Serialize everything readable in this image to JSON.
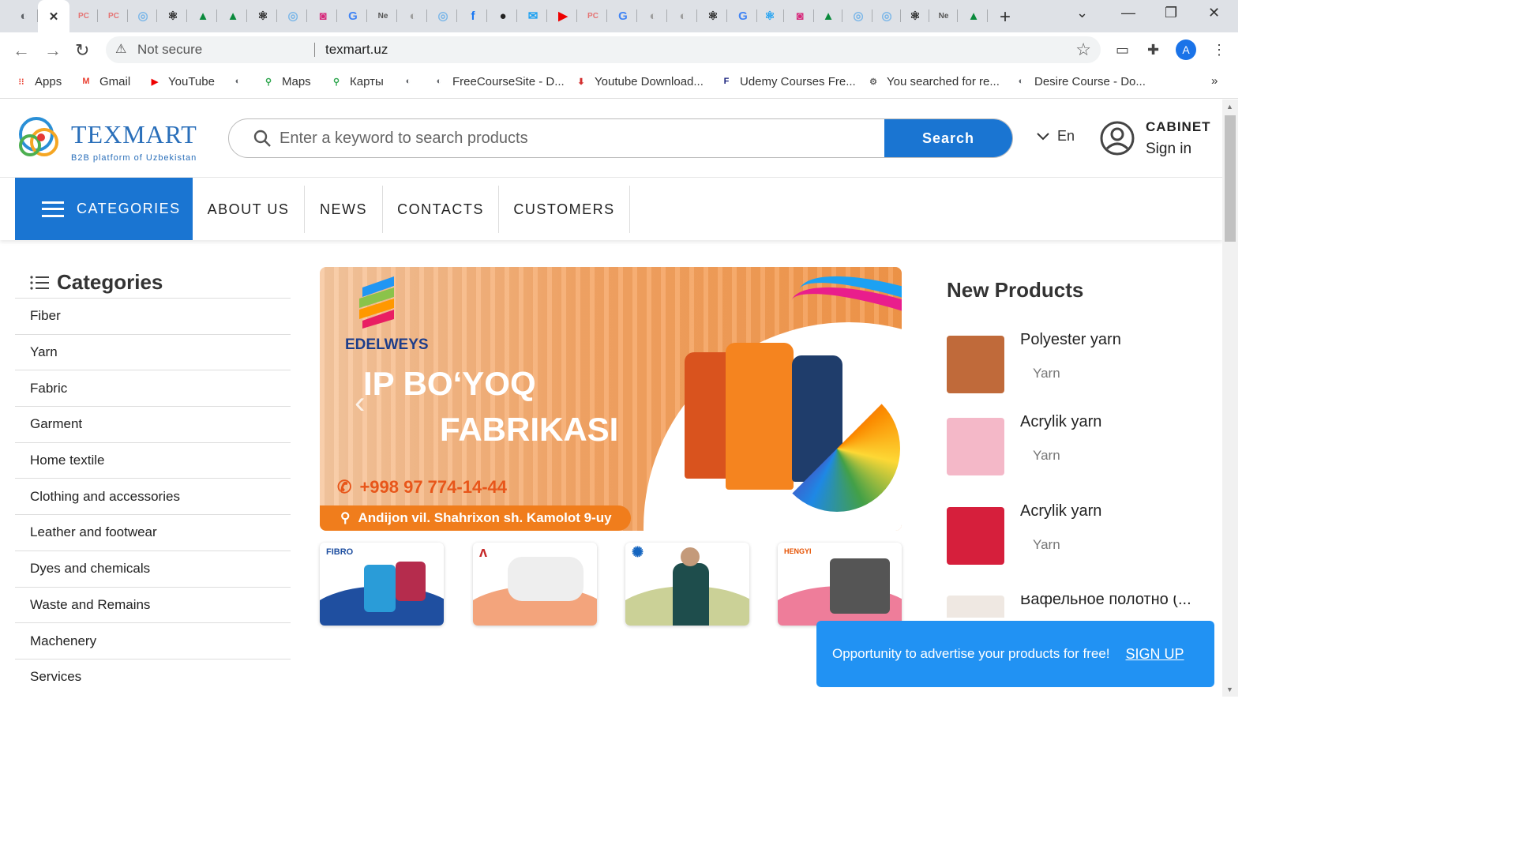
{
  "browser": {
    "tabs": [
      {
        "icon": "globe-icon",
        "color": "#5f6368",
        "glyph": "◐"
      },
      {
        "icon": "close-tab-icon",
        "color": "#333",
        "glyph": "✕",
        "active": true
      },
      {
        "icon": "pc-icon",
        "color": "#e57373",
        "glyph": "PC"
      },
      {
        "icon": "pc-icon",
        "color": "#e57373",
        "glyph": "PC"
      },
      {
        "icon": "swirl-icon",
        "color": "#7cb7e8",
        "glyph": "◎"
      },
      {
        "icon": "react-icon",
        "color": "#222",
        "glyph": "⚛"
      },
      {
        "icon": "grad-icon",
        "color": "#0a8a3c",
        "glyph": "▲"
      },
      {
        "icon": "grad-icon",
        "color": "#0a8a3c",
        "glyph": "▲"
      },
      {
        "icon": "react-icon",
        "color": "#222",
        "glyph": "⚛"
      },
      {
        "icon": "swirl-icon",
        "color": "#7cb7e8",
        "glyph": "◎"
      },
      {
        "icon": "instagram-icon",
        "color": "#d6297b",
        "glyph": "◙"
      },
      {
        "icon": "google-icon",
        "color": "#4285f4",
        "glyph": "G"
      },
      {
        "icon": "text-tab-icon",
        "color": "#555",
        "glyph": "Ne"
      },
      {
        "icon": "globe-icon",
        "color": "#9e9e9e",
        "glyph": "◐"
      },
      {
        "icon": "swirl-icon",
        "color": "#7cb7e8",
        "glyph": "◎"
      },
      {
        "icon": "facebook-icon",
        "color": "#1877f2",
        "glyph": "f"
      },
      {
        "icon": "github-icon",
        "color": "#222",
        "glyph": "●"
      },
      {
        "icon": "messenger-icon",
        "color": "#1da1f2",
        "glyph": "✉"
      },
      {
        "icon": "youtube-icon",
        "color": "#e00",
        "glyph": "▶"
      },
      {
        "icon": "pc-icon",
        "color": "#e57373",
        "glyph": "PC"
      },
      {
        "icon": "google-icon",
        "color": "#4285f4",
        "glyph": "G"
      },
      {
        "icon": "globe-icon",
        "color": "#9e9e9e",
        "glyph": "◐"
      },
      {
        "icon": "globe-icon",
        "color": "#9e9e9e",
        "glyph": "◐"
      },
      {
        "icon": "react-icon",
        "color": "#222",
        "glyph": "⚛"
      },
      {
        "icon": "google-icon",
        "color": "#4285f4",
        "glyph": "G"
      },
      {
        "icon": "react-icon",
        "color": "#1da1f2",
        "glyph": "⚛"
      },
      {
        "icon": "instagram-icon",
        "color": "#d6297b",
        "glyph": "◙"
      },
      {
        "icon": "grad-icon",
        "color": "#0a8a3c",
        "glyph": "▲"
      },
      {
        "icon": "swirl-icon",
        "color": "#7cb7e8",
        "glyph": "◎"
      },
      {
        "icon": "swirl-icon",
        "color": "#7cb7e8",
        "glyph": "◎"
      },
      {
        "icon": "react-icon",
        "color": "#222",
        "glyph": "⚛"
      },
      {
        "icon": "text-tab-icon",
        "color": "#555",
        "glyph": "Ne"
      },
      {
        "icon": "grad-icon",
        "color": "#0a8a3c",
        "glyph": "▲"
      }
    ],
    "address": {
      "security": "Not secure",
      "url": "texmart.uz"
    },
    "bookmarks": [
      {
        "label": "Apps",
        "icon": "apps-grid-icon"
      },
      {
        "label": "Gmail",
        "icon": "gmail-icon"
      },
      {
        "label": "YouTube",
        "icon": "youtube-icon"
      },
      {
        "label": "",
        "icon": "globe-icon"
      },
      {
        "label": "Maps",
        "icon": "maps-pin-icon"
      },
      {
        "label": "Карты",
        "icon": "maps-pin-icon"
      },
      {
        "label": "",
        "icon": "globe-icon"
      },
      {
        "label": "FreeCourseSite - D...",
        "icon": "globe-icon"
      },
      {
        "label": "Youtube Download...",
        "icon": "download-icon"
      },
      {
        "label": "Udemy Courses Fre...",
        "icon": "free-download-icon"
      },
      {
        "label": "You searched for re...",
        "icon": "gear-logo-icon"
      },
      {
        "label": "Desire Course - Do...",
        "icon": "globe-icon"
      }
    ],
    "more_bookmarks": "»"
  },
  "site": {
    "logo": {
      "name": "TEXMART",
      "tagline": "B2B platform of Uzbekistan"
    },
    "search": {
      "placeholder": "Enter a keyword to search products",
      "button": "Search"
    },
    "language": "En",
    "cabinet": {
      "title": "CABINET",
      "signin": "Sign in"
    },
    "nav": {
      "categories": "CATEGORIES",
      "items": [
        "ABOUT US",
        "NEWS",
        "CONTACTS",
        "CUSTOMERS"
      ]
    },
    "sidebar": {
      "title": "Categories",
      "items": [
        "Fiber",
        "Yarn",
        "Fabric",
        "Garment",
        "Home textile",
        "Clothing and accessories",
        "Leather and footwear",
        "Dyes and chemicals",
        "Waste and Remains",
        "Machenery",
        "Services"
      ]
    },
    "banner": {
      "brand": "EDELWEYS",
      "line1": "IP BO‘YOQ",
      "line2": "FABRIKASI",
      "phone": "+998 97 774-14-44",
      "address": "Andijon vil. Shahrixon sh. Kamolot 9-uy"
    },
    "thumbs": [
      {
        "label": "FIBRO",
        "wave": "#1f4fa0"
      },
      {
        "label": "",
        "wave": "#f3a47c"
      },
      {
        "label": "",
        "wave": "#cbd197"
      },
      {
        "label": "HENGYI",
        "wave": "#ee7d9a"
      }
    ],
    "new_products": {
      "title": "New Products",
      "items": [
        {
          "name": "Polyester yarn",
          "category": "Yarn",
          "img": "#c06a3a"
        },
        {
          "name": "Acrylik yarn",
          "category": "Yarn",
          "img": "#f4b8c8"
        },
        {
          "name": "Acrylik yarn",
          "category": "Yarn",
          "img": "#d61f3c"
        },
        {
          "name": "Вафельное полотно (...",
          "category": "",
          "img": "#efe8e2"
        }
      ]
    },
    "popup": {
      "text": "Opportunity to advertise your products for free!",
      "link": "SIGN UP"
    }
  }
}
